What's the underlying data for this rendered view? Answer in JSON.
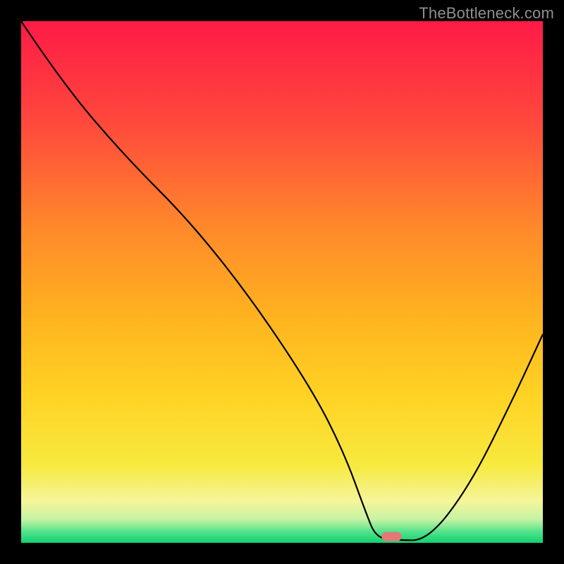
{
  "watermark": "TheBottleneck.com",
  "chart_data": {
    "type": "line",
    "title": "",
    "xlabel": "",
    "ylabel": "",
    "xlim": [
      0,
      100
    ],
    "ylim": [
      0,
      100
    ],
    "grid": false,
    "legend": false,
    "annotations": [],
    "background_gradient": {
      "type": "vertical",
      "stops": [
        {
          "pos": 0.0,
          "color": "#ff1a46"
        },
        {
          "pos": 0.2,
          "color": "#ff4a3c"
        },
        {
          "pos": 0.4,
          "color": "#ff8a2a"
        },
        {
          "pos": 0.58,
          "color": "#ffb61f"
        },
        {
          "pos": 0.72,
          "color": "#ffd324"
        },
        {
          "pos": 0.85,
          "color": "#f7e93e"
        },
        {
          "pos": 0.92,
          "color": "#f5f59a"
        },
        {
          "pos": 0.955,
          "color": "#c6f3a3"
        },
        {
          "pos": 0.98,
          "color": "#4de28a"
        },
        {
          "pos": 1.0,
          "color": "#12d06f"
        }
      ]
    },
    "series": [
      {
        "name": "bottleneck-curve",
        "color": "#000000",
        "x": [
          0,
          8,
          20,
          32,
          44,
          56,
          62,
          66,
          68,
          72,
          78,
          86,
          94,
          100
        ],
        "y": [
          100,
          88,
          74,
          62,
          47,
          29,
          17,
          6,
          1,
          0.5,
          0.5,
          11,
          27,
          40
        ]
      }
    ],
    "marker": {
      "name": "selected-marker",
      "x": 71,
      "y": 1.2,
      "color": "#e47877",
      "shape": "rounded-rect"
    }
  }
}
